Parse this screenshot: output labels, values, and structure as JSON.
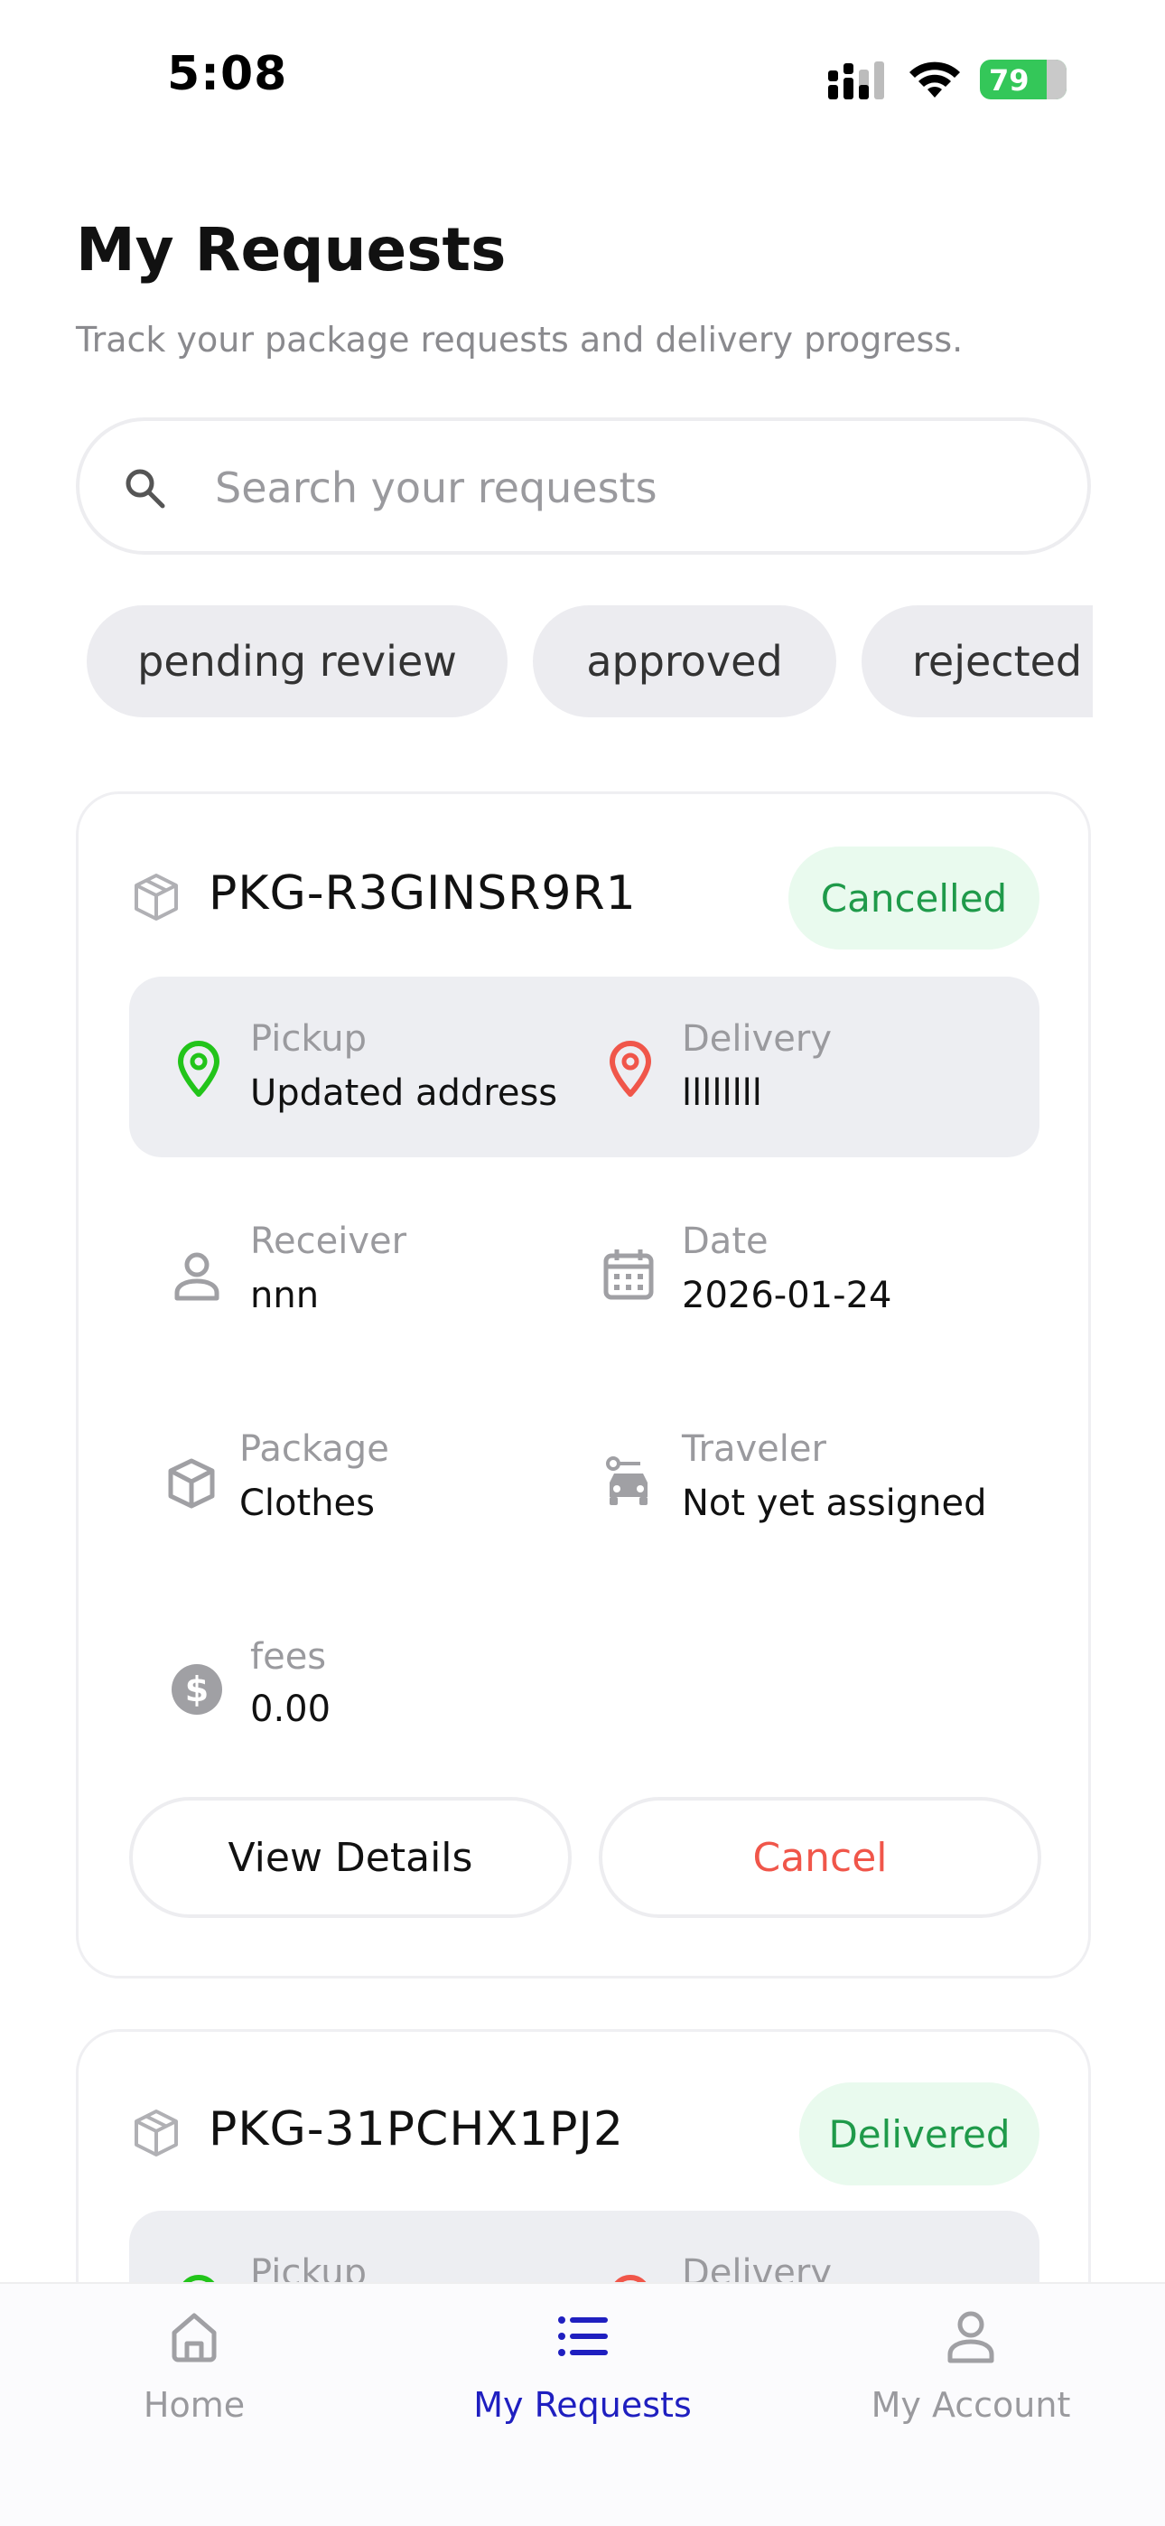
{
  "status_bar": {
    "time": "5:08",
    "battery": "79"
  },
  "header": {
    "title": "My Requests",
    "subtitle": "Track your package requests and delivery progress."
  },
  "search": {
    "placeholder": "Search your requests",
    "value": ""
  },
  "filters": [
    "pending review",
    "approved",
    "rejected"
  ],
  "requests": [
    {
      "id": "PKG-R3GINSR9R1",
      "status": "Cancelled",
      "pickup_label": "Pickup",
      "pickup_value": "Updated address",
      "delivery_label": "Delivery",
      "delivery_value": "llllllll",
      "receiver_label": "Receiver",
      "receiver_value": "nnn",
      "date_label": "Date",
      "date_value": "2026-01-24",
      "package_label": "Package",
      "package_value": "Clothes",
      "traveler_label": "Traveler",
      "traveler_value": "Not yet assigned",
      "fees_label": "fees",
      "fees_value": "0.00",
      "view_details_label": "View Details",
      "cancel_label": "Cancel"
    },
    {
      "id": "PKG-31PCHX1PJ2",
      "status": "Delivered",
      "pickup_label": "Pickup",
      "delivery_label": "Delivery"
    }
  ],
  "tabbar": {
    "home": "Home",
    "my_requests": "My Requests",
    "my_account": "My Account"
  },
  "colors": {
    "accent": "#1f1fc0",
    "status_green": "#1f9a4a",
    "status_green_bg": "#e9faee",
    "danger": "#f0564a",
    "pickup_pin": "#22c41a",
    "delivery_pin": "#f0564a"
  },
  "icons": {
    "search": "search-icon",
    "package": "package-icon",
    "pickup": "location-pin-icon",
    "delivery": "location-pin-icon",
    "receiver": "person-icon",
    "date": "calendar-icon",
    "traveler": "car-icon",
    "fees": "dollar-icon",
    "home": "home-icon",
    "requests": "list-icon",
    "account": "person-icon"
  }
}
